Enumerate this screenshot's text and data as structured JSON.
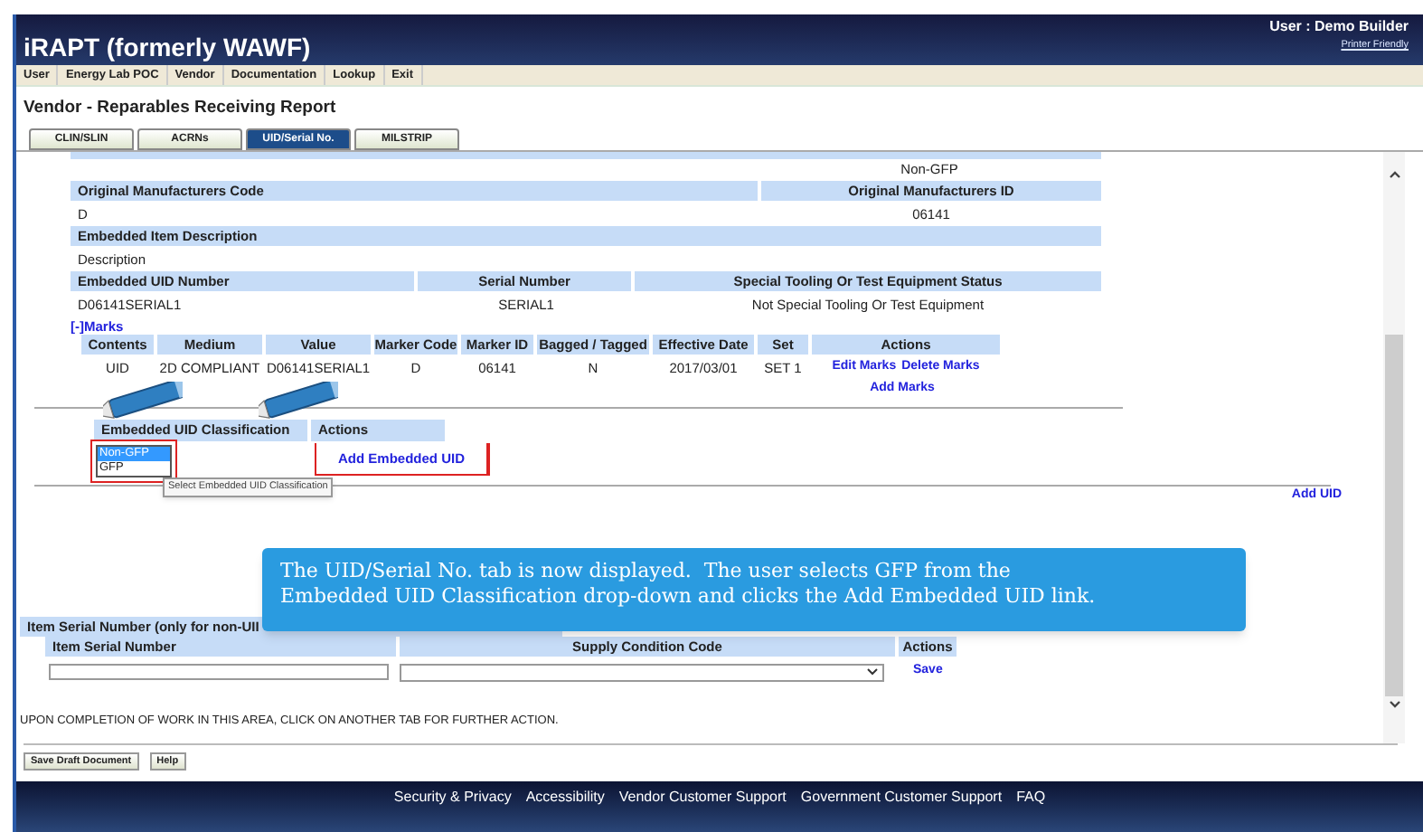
{
  "app": {
    "title": "iRAPT (formerly WAWF)",
    "user": "User : Demo Builder",
    "printer_friendly": "Printer Friendly"
  },
  "menu": [
    "User",
    "Energy Lab POC",
    "Vendor",
    "Documentation",
    "Lookup",
    "Exit"
  ],
  "page_title": "Vendor - Reparables Receiving Report",
  "tabs": [
    {
      "label": "CLIN/SLIN",
      "selected": false
    },
    {
      "label": "ACRNs",
      "selected": false
    },
    {
      "label": "UID/Serial No.",
      "selected": true
    },
    {
      "label": "MILSTRIP",
      "selected": false
    }
  ],
  "top_value": "Non-GFP",
  "manufacturer": {
    "code_label": "Original Manufacturers Code",
    "code": "D",
    "id_label": "Original Manufacturers ID",
    "id": "06141"
  },
  "description": {
    "label": "Embedded Item Description",
    "value": "Description"
  },
  "embedded_uid": {
    "uid_label": "Embedded UID Number",
    "uid": "D06141SERIAL1",
    "serial_label": "Serial Number",
    "serial": "SERIAL1",
    "status_label": "Special Tooling Or Test Equipment Status",
    "status": "Not Special Tooling Or Test Equipment"
  },
  "marks": {
    "toggle": "[-]Marks",
    "columns": [
      "Contents",
      "Medium",
      "Value",
      "Marker Code",
      "Marker ID",
      "Bagged / Tagged",
      "Effective Date",
      "Set",
      "Actions"
    ],
    "rows": [
      {
        "cells": [
          "UID",
          "2D COMPLIANT",
          "D06141SERIAL1",
          "D",
          "06141",
          "N",
          "2017/03/01",
          "SET 1"
        ],
        "actions": [
          "Edit Marks",
          "Delete Marks"
        ]
      }
    ],
    "add_link": "Add Marks"
  },
  "classification": {
    "columns": [
      "Embedded UID Classification",
      "Actions"
    ],
    "options": [
      {
        "label": "Non-GFP",
        "selected": true
      },
      {
        "label": "GFP",
        "selected": false
      }
    ],
    "tooltip": "Select Embedded UID Classification",
    "action": "Add Embedded UID"
  },
  "add_uid": "Add UID",
  "callout": [
    "The UID/Serial No. tab is now displayed.  The user selects GFP from the",
    "Embedded UID Classification drop-down and clicks the Add Embedded UID link."
  ],
  "item_serial": {
    "title": "Item Serial Number (only for non-UII",
    "columns": [
      "Item Serial Number",
      "Supply Condition Code",
      "Actions"
    ],
    "action": "Save"
  },
  "notice": "UPON COMPLETION OF WORK IN THIS AREA, CLICK ON ANOTHER TAB FOR FURTHER ACTION.",
  "buttons": [
    "Save Draft Document",
    "Help"
  ],
  "footer_links": [
    "Security & Privacy",
    "Accessibility",
    "Vendor Customer Support",
    "Government Customer Support",
    "FAQ"
  ]
}
